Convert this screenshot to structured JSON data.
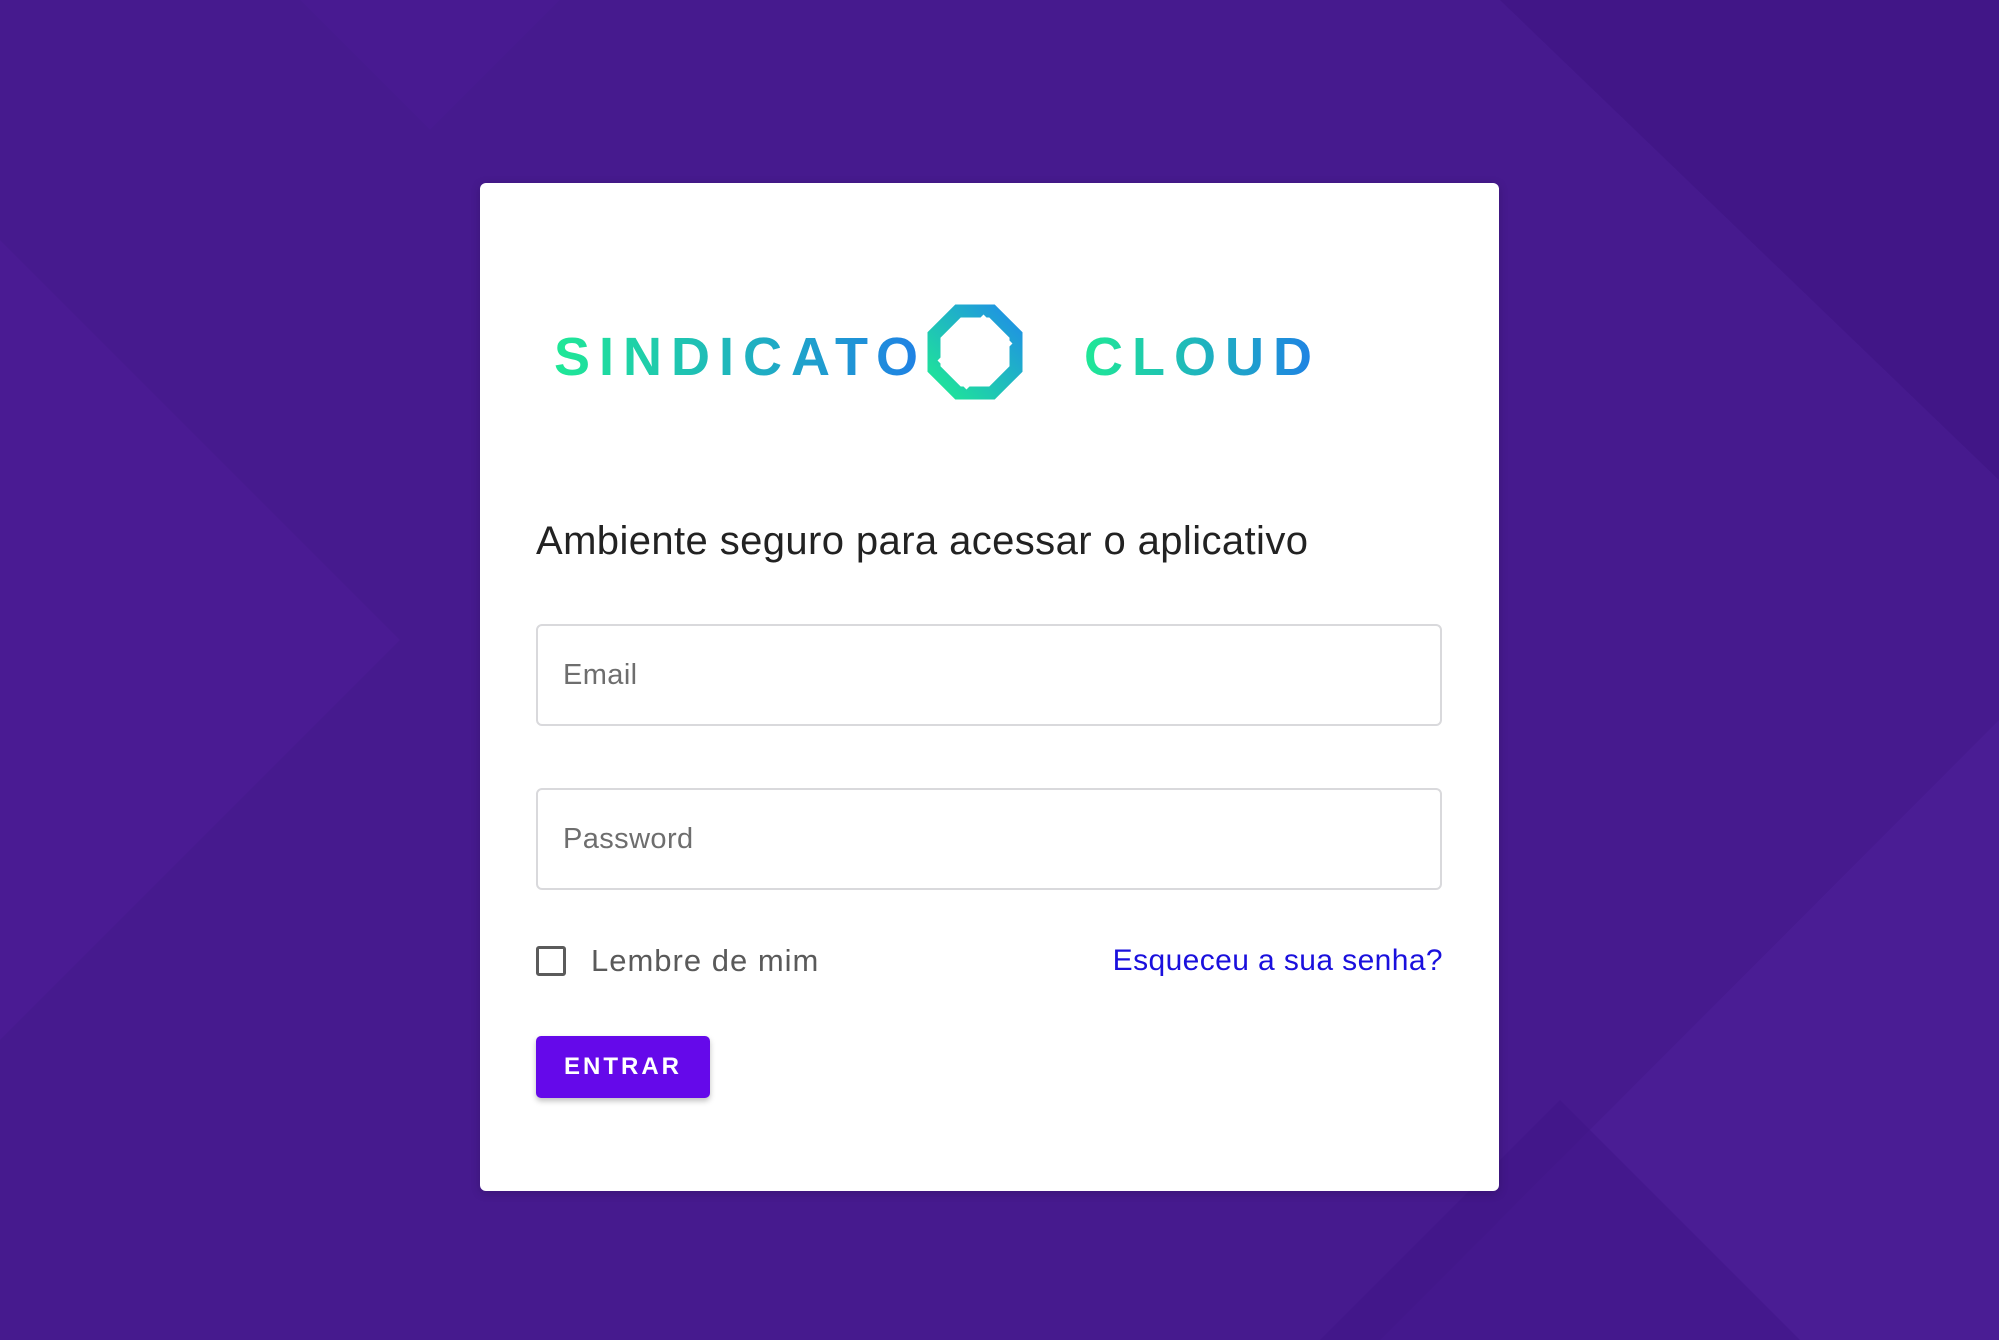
{
  "background_color": "#461a8e",
  "logo": {
    "text_left": "SINDICATO",
    "text_right": "CLOUD",
    "gradient_start": "#1fe896",
    "gradient_end": "#1f7fe6"
  },
  "heading": "Ambiente seguro para acessar o aplicativo",
  "email_field": {
    "placeholder": "Email",
    "value": ""
  },
  "password_field": {
    "placeholder": "Password",
    "value": ""
  },
  "remember_me": {
    "label": "Lembre de mim",
    "checked": false
  },
  "forgot_password": {
    "label": "Esqueceu a sua senha?",
    "color": "#1a10dd"
  },
  "login_button": {
    "label": "ENTRAR",
    "color": "#6509ea"
  }
}
